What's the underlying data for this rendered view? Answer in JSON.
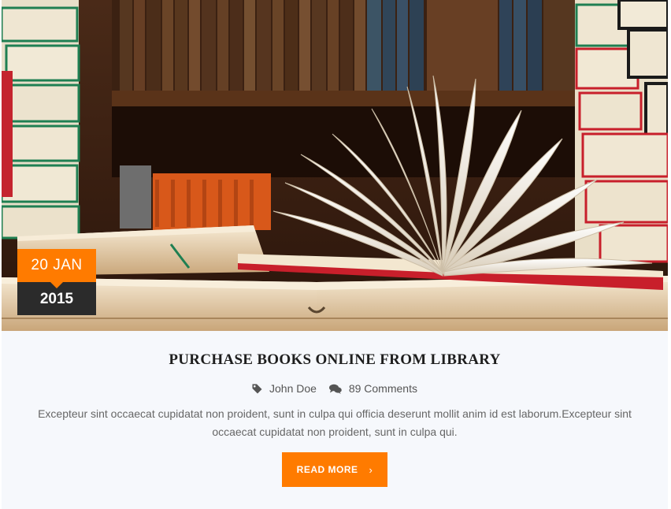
{
  "post": {
    "date": {
      "day_month": "20 JAN",
      "year": "2015"
    },
    "title": "PURCHASE BOOKS ONLINE FROM LIBRARY",
    "meta": {
      "author_icon": "tag-icon",
      "author": "John Doe",
      "comments_icon": "comments-icon",
      "comments": "89 Comments"
    },
    "excerpt": "Excepteur sint occaecat cupidatat non proident, sunt in culpa qui officia deserunt mollit anim id est laborum.Excepteur sint occaecat cupidatat non proident, sunt in culpa qui.",
    "read_more_label": "READ MORE",
    "read_more_icon": "chevron-right-icon"
  },
  "colors": {
    "accent": "#ff7b00",
    "badge_dark": "#2b2b2b",
    "card_bg": "#f6f8fc",
    "title": "#1e1e1e",
    "text": "#666666"
  }
}
